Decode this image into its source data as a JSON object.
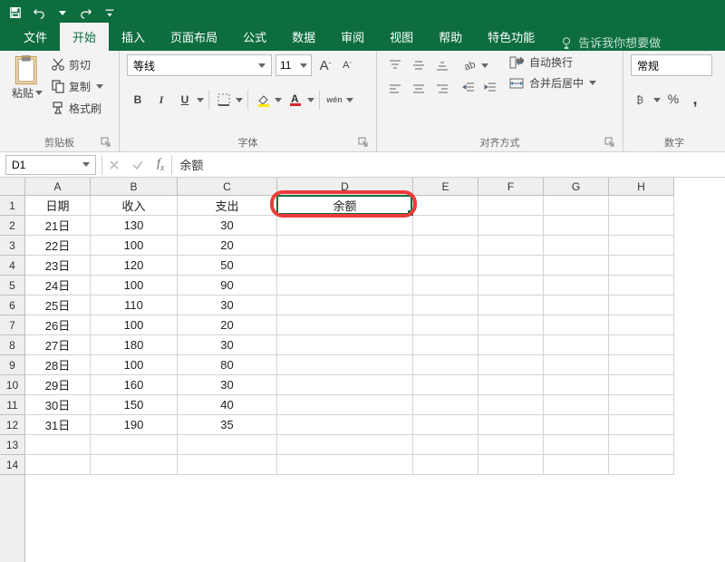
{
  "qat": {
    "save": "save-icon",
    "undo": "undo-icon",
    "redo": "redo-icon"
  },
  "tabs": {
    "file": "文件",
    "home": "开始",
    "insert": "插入",
    "layout": "页面布局",
    "formulas": "公式",
    "data": "数据",
    "review": "审阅",
    "view": "视图",
    "help": "帮助",
    "features": "特色功能",
    "tellme": "告诉我你想要做"
  },
  "ribbon": {
    "clipboard": {
      "paste": "粘贴",
      "cut": "剪切",
      "copy": "复制",
      "format_painter": "格式刷",
      "group": "剪贴板"
    },
    "font": {
      "name": "等线",
      "size": "11",
      "grow": "A",
      "shrink": "A",
      "bold": "B",
      "italic": "I",
      "underline": "U",
      "ruby": "wén",
      "group": "字体"
    },
    "alignment": {
      "wrap": "自动换行",
      "merge": "合并后居中",
      "group": "对齐方式"
    },
    "number": {
      "format": "常规",
      "percent": "%",
      "comma": ",",
      "group": "数字"
    }
  },
  "namebox": "D1",
  "formula_value": "余额",
  "columns": [
    "A",
    "B",
    "C",
    "D",
    "E",
    "F",
    "G",
    "H"
  ],
  "col_widths": {
    "A": 72,
    "B": 96,
    "C": 110,
    "D": 150,
    "E": 72,
    "F": 72,
    "G": 72,
    "H": 72
  },
  "headers": {
    "date": "日期",
    "income": "收入",
    "expense": "支出",
    "balance": "余额"
  },
  "rows": [
    {
      "n": 1,
      "date": "日期",
      "income": "收入",
      "expense": "支出",
      "balance": "余额"
    },
    {
      "n": 2,
      "date": "21日",
      "income": "130",
      "expense": "30",
      "balance": ""
    },
    {
      "n": 3,
      "date": "22日",
      "income": "100",
      "expense": "20",
      "balance": ""
    },
    {
      "n": 4,
      "date": "23日",
      "income": "120",
      "expense": "50",
      "balance": ""
    },
    {
      "n": 5,
      "date": "24日",
      "income": "100",
      "expense": "90",
      "balance": ""
    },
    {
      "n": 6,
      "date": "25日",
      "income": "110",
      "expense": "30",
      "balance": ""
    },
    {
      "n": 7,
      "date": "26日",
      "income": "100",
      "expense": "20",
      "balance": ""
    },
    {
      "n": 8,
      "date": "27日",
      "income": "180",
      "expense": "30",
      "balance": ""
    },
    {
      "n": 9,
      "date": "28日",
      "income": "100",
      "expense": "80",
      "balance": ""
    },
    {
      "n": 10,
      "date": "29日",
      "income": "160",
      "expense": "30",
      "balance": ""
    },
    {
      "n": 11,
      "date": "30日",
      "income": "150",
      "expense": "40",
      "balance": ""
    },
    {
      "n": 12,
      "date": "31日",
      "income": "190",
      "expense": "35",
      "balance": ""
    },
    {
      "n": 13,
      "date": "",
      "income": "",
      "expense": "",
      "balance": ""
    },
    {
      "n": 14,
      "date": "",
      "income": "",
      "expense": "",
      "balance": ""
    }
  ],
  "selected_cell": {
    "col": "D",
    "row": 1
  }
}
